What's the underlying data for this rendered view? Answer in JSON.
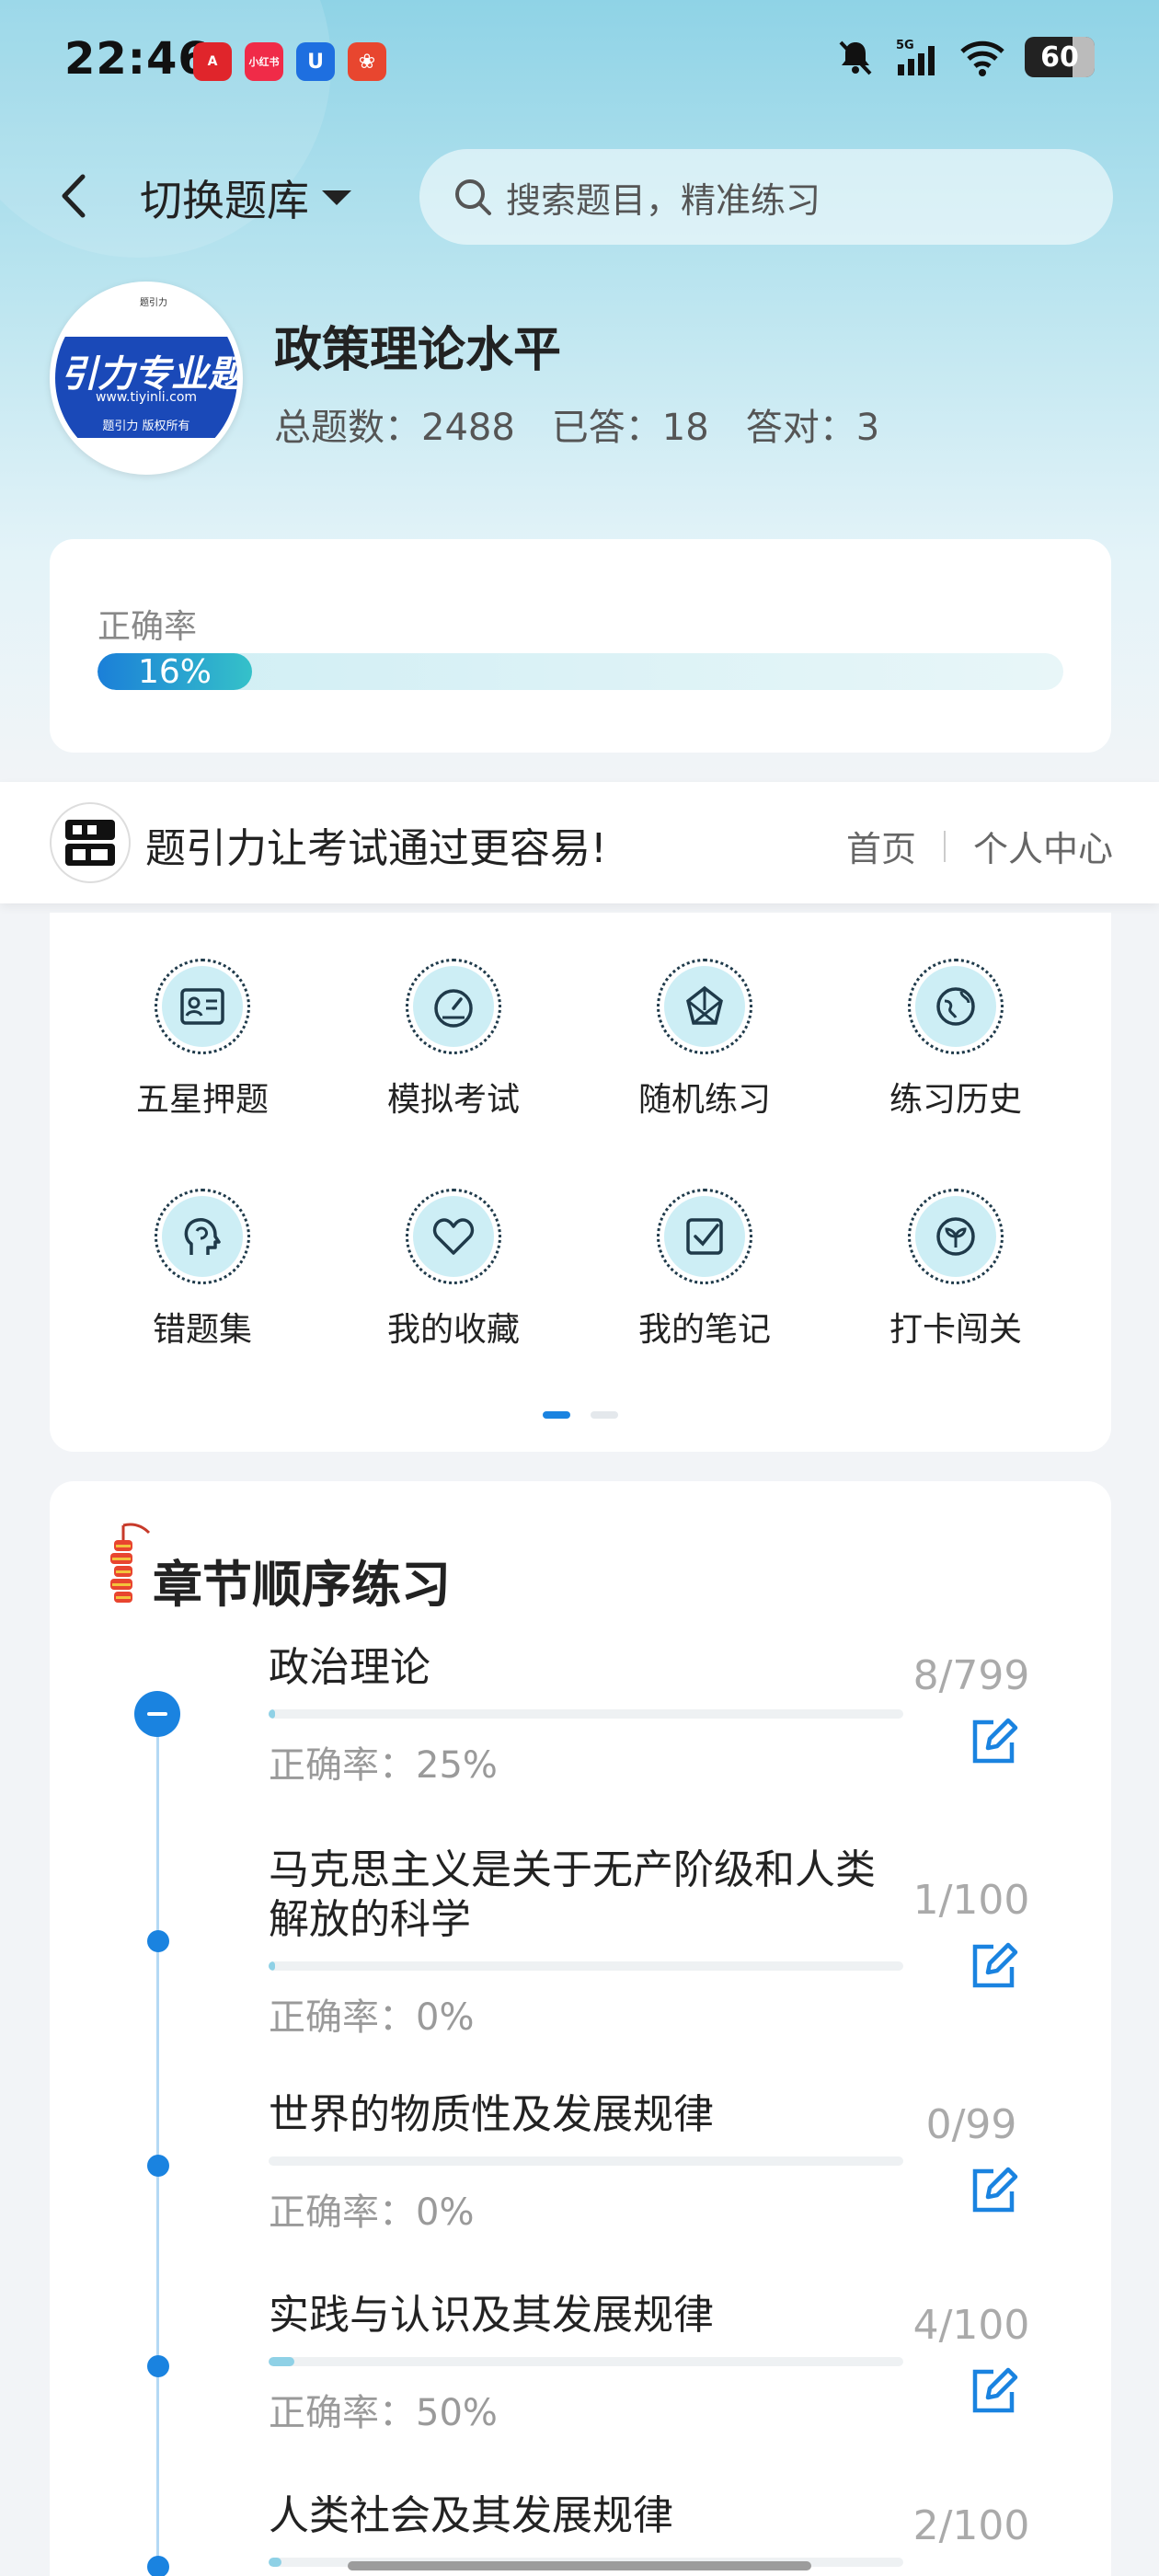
{
  "status_bar": {
    "time": "22:46",
    "app_badges": [
      {
        "icon": "app-a-icon",
        "color": "#e0252b",
        "text": "A"
      },
      {
        "icon": "xiaohongshu-icon",
        "color": "#f02b48",
        "text": "小红书"
      },
      {
        "icon": "app-u-icon",
        "color": "#1e6fe0",
        "text": "U"
      },
      {
        "icon": "app-game-icon",
        "color": "#e8462f",
        "text": "❀"
      }
    ],
    "network": "5G",
    "battery": "60"
  },
  "header": {
    "switch_label": "切换题库",
    "search_placeholder": "搜索题目，精准练习"
  },
  "bank": {
    "avatar_text": "引力专业题",
    "avatar_url": "www.tiyinli.com",
    "avatar_copyright": "题引力 版权所有",
    "avatar_top": "题引力",
    "title": "政策理论水平",
    "total": "总题数：2488",
    "answered": "已答：18",
    "correct": "答对：3"
  },
  "accuracy": {
    "label": "正确率",
    "value_text": "16%",
    "value": 0.16
  },
  "brand": {
    "slogan": "题引力让考试通过更容易!",
    "link_home": "首页",
    "link_profile": "个人中心"
  },
  "functions": [
    {
      "label": "五星押题",
      "icon": "id-card-icon"
    },
    {
      "label": "模拟考试",
      "icon": "speedometer-icon"
    },
    {
      "label": "随机练习",
      "icon": "random-icon"
    },
    {
      "label": "练习历史",
      "icon": "globe-history-icon"
    },
    {
      "label": "错题集",
      "icon": "head-icon"
    },
    {
      "label": "我的收藏",
      "icon": "heart-icon"
    },
    {
      "label": "我的笔记",
      "icon": "check-note-icon"
    },
    {
      "label": "打卡闯关",
      "icon": "sprout-icon"
    }
  ],
  "chapters": {
    "title": "章节顺序练习",
    "items": [
      {
        "name": "政治理论",
        "accuracy": "正确率：25%",
        "count": "8/799",
        "progress": 0.01
      },
      {
        "name": "马克思主义是关于无产阶级和人类解放的科学",
        "accuracy": "正确率：0%",
        "count": "1/100",
        "progress": 0.01
      },
      {
        "name": "世界的物质性及发展规律",
        "accuracy": "正确率：0%",
        "count": "0/99",
        "progress": 0
      },
      {
        "name": "实践与认识及其发展规律",
        "accuracy": "正确率：50%",
        "count": "4/100",
        "progress": 0.04
      },
      {
        "name": "人类社会及其发展规律",
        "accuracy": "",
        "count": "2/100",
        "progress": 0.02
      }
    ]
  },
  "colors": {
    "accent": "#1a83e0",
    "icon_bg": "#cdeef5"
  }
}
